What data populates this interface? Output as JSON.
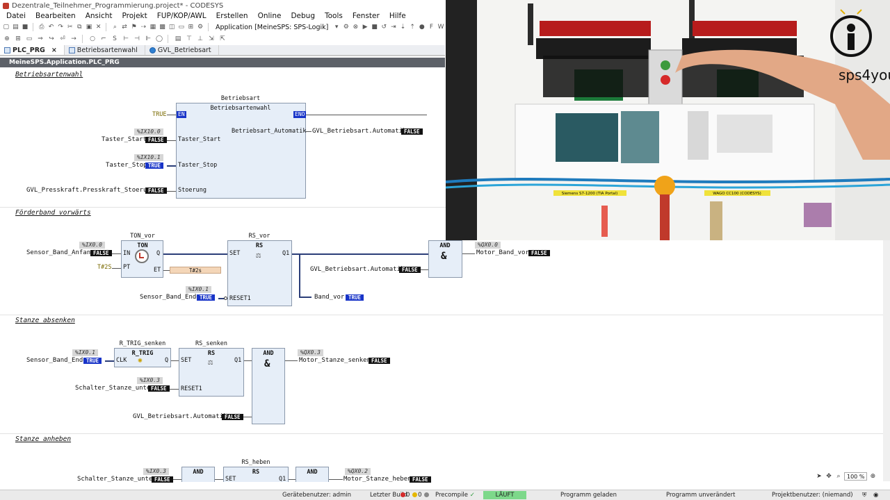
{
  "window": {
    "title": "Dezentrale_Teilnehmer_Programmierung.project* - CODESYS"
  },
  "menu": [
    "Datei",
    "Bearbeiten",
    "Ansicht",
    "Projekt",
    "FUP/KOP/AWL",
    "Erstellen",
    "Online",
    "Debug",
    "Tools",
    "Fenster",
    "Hilfe"
  ],
  "toolbar": {
    "application": "Application [MeineSPS: SPS-Logik]"
  },
  "tabs": [
    {
      "label": "PLC_PRG",
      "close": "×"
    },
    {
      "label": "Betriebsartenwahl"
    },
    {
      "label": "GVL_Betriebsart"
    }
  ],
  "breadcrumb": "MeineSPS.Application.PLC_PRG",
  "networks": {
    "n1": {
      "title": "Betriebsartenwahl",
      "instance": "Betriebsart",
      "type": "Betriebsartenwahl",
      "en_const": "TRUE",
      "en_pin": "EN",
      "eno_pin": "ENO",
      "in1_addr": "%IX10.0",
      "in1_var": "Taster_Start",
      "in1_val": "FALSE",
      "in1_pin": "Taster_Start",
      "in2_addr": "%IX10.1",
      "in2_var": "Taster_Stop",
      "in2_val": "TRUE",
      "in2_pin": "Taster_Stop",
      "in3_var": "GVL_Presskraft.Presskraft_Stoerung",
      "in3_val": "FALSE",
      "in3_pin": "Stoerung",
      "out_pin": "Betriebsart_Automatik",
      "out_var": "GVL_Betriebsart.Automatik",
      "out_val": "FALSE"
    },
    "n2": {
      "title": "Förderband vorwärts",
      "ton_instance": "TON_vor",
      "ton_type": "TON",
      "ton_in_addr": "%IX0.0",
      "ton_in_var": "Sensor_Band_Anfang",
      "ton_in_val": "FALSE",
      "ton_pt": "T#2S",
      "ton_et": "T#2s",
      "ton_pin_in": "IN",
      "ton_pin_pt": "PT",
      "ton_pin_q": "Q",
      "ton_pin_et": "ET",
      "rs_instance": "RS_vor",
      "rs_type": "RS",
      "rs_set": "SET",
      "rs_reset": "RESET1",
      "rs_q": "Q1",
      "reset_addr": "%IX0.1",
      "reset_var": "Sensor_Band_Ende",
      "reset_val": "TRUE",
      "and_type": "AND",
      "and_sym": "&",
      "auto_var": "GVL_Betriebsart.Automatik",
      "auto_val": "FALSE",
      "band_var": "Band_vor",
      "band_val": "TRUE",
      "out_addr": "%QX0.0",
      "out_var": "Motor_Band_vor",
      "out_val": "FALSE"
    },
    "n3": {
      "title": "Stanze absenken",
      "rtrig_instance": "R_TRIG_senken",
      "rtrig_type": "R_TRIG",
      "rtrig_clk": "CLK",
      "rtrig_q": "Q",
      "clk_addr": "%IX0.1",
      "clk_var": "Sensor_Band_Ende",
      "clk_val": "TRUE",
      "rs_instance": "RS_senken",
      "rs_type": "RS",
      "rs_set": "SET",
      "rs_reset": "RESET1",
      "rs_q": "Q1",
      "reset_addr": "%IX0.3",
      "reset_var": "Schalter_Stanze_unten",
      "reset_val": "FALSE",
      "and_type": "AND",
      "and_sym": "&",
      "auto_var": "GVL_Betriebsart.Automatik",
      "auto_val": "FALSE",
      "out_addr": "%QX0.3",
      "out_var": "Motor_Stanze_senken",
      "out_val": "FALSE"
    },
    "n4": {
      "title": "Stanze anheben",
      "in_addr": "%IX0.3",
      "in_var": "Schalter_Stanze_unten",
      "in_val": "FALSE",
      "and1_type": "AND",
      "rs_instance": "RS_heben",
      "rs_type": "RS",
      "rs_set": "SET",
      "rs_q": "Q1",
      "and2_type": "AND",
      "out_addr": "%QX0.2",
      "out_var": "Motor_Stanze_heben",
      "out_val": "FALSE"
    }
  },
  "video": {
    "brand": "sps4you",
    "label_left": "Siemens S7-1200 (TIA Portal)",
    "label_right": "WAGO CC100 (CODESYS)"
  },
  "zoom": "100 %",
  "status": {
    "device_user": "Gerätebenutzer: admin",
    "last_build": "Letzter Build",
    "errors": "0",
    "warnings": "0",
    "precompile": "Precompile",
    "run_state": "LÄUFT",
    "loaded": "Programm geladen",
    "unchanged": "Programm unverändert",
    "project_user": "Projektbenutzer: (niemand)"
  },
  "colors": {
    "wire": "#2a3d78",
    "true_bg": "#1834c8",
    "false_bg": "#111111",
    "run_green": "#7dd88a"
  }
}
